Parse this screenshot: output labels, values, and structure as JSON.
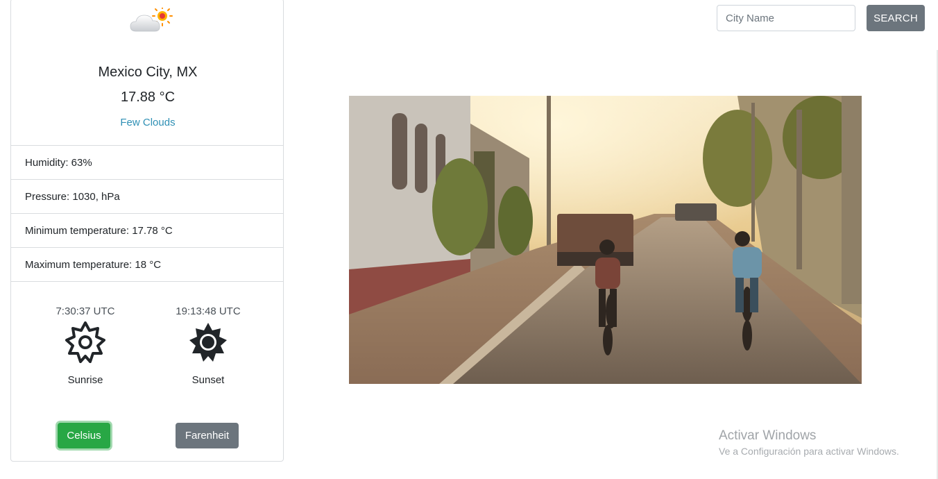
{
  "weather": {
    "icon": "few-clouds-icon",
    "city": "Mexico City, MX",
    "temperature": "17.88 °C",
    "description": "Few Clouds"
  },
  "details": [
    {
      "label": "Humidity: 63%"
    },
    {
      "label": "Pressure: 1030, hPa"
    },
    {
      "label": "Minimum temperature: 17.78 °C"
    },
    {
      "label": "Maximum temperature: 18 °C"
    }
  ],
  "sun": {
    "sunrise_time": "7:30:37 UTC",
    "sunrise_label": "Sunrise",
    "sunrise_icon": "sunrise-icon",
    "sunset_time": "19:13:48 UTC",
    "sunset_label": "Sunset",
    "sunset_icon": "sunset-icon"
  },
  "units": {
    "celsius_label": "Celsius",
    "farenheit_label": "Farenheit",
    "active": "Celsius"
  },
  "search": {
    "placeholder": "City Name",
    "value": "",
    "button_label": "SEARCH"
  },
  "photo": {
    "subject": "city-street-photo"
  },
  "watermark": {
    "title": "Activar Windows",
    "subtitle": "Ve a Configuración para activar Windows."
  },
  "colors": {
    "accent_text": "#2f90b5",
    "success": "#28a745",
    "secondary": "#6c757d"
  }
}
